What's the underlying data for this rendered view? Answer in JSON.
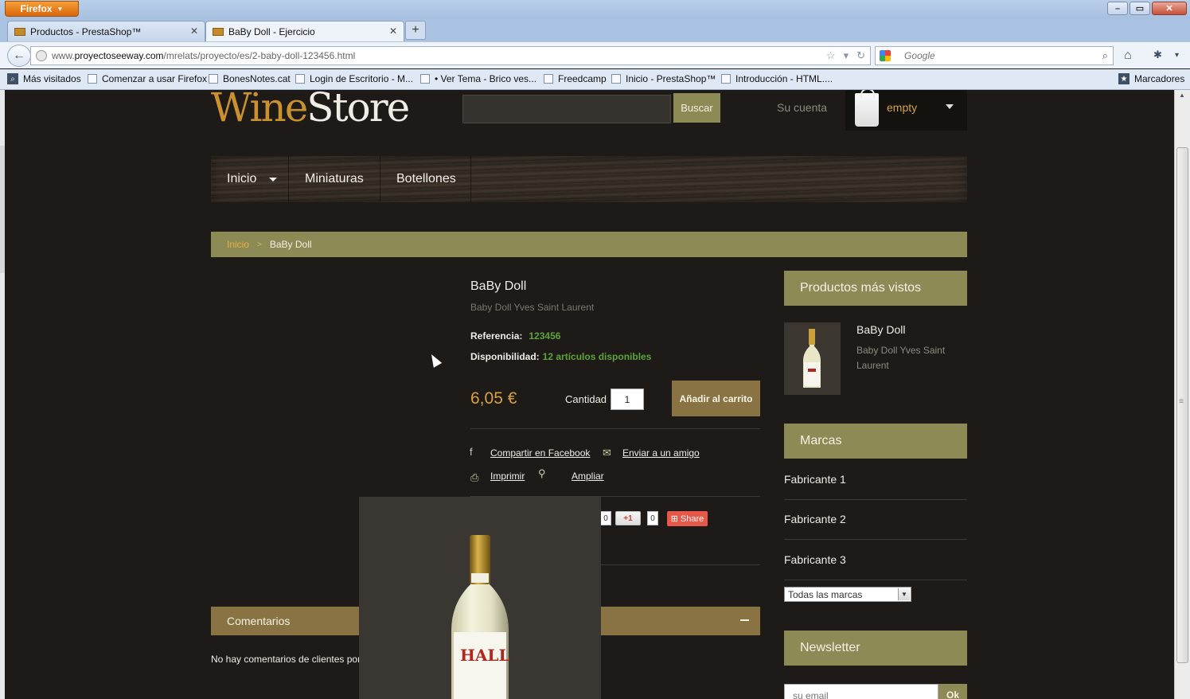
{
  "browser": {
    "app_button": "Firefox",
    "tabs": [
      {
        "title": "Productos - PrestaShop™",
        "active": false
      },
      {
        "title": "BaBy Doll - Ejercicio",
        "active": true
      }
    ],
    "url_prefix": "www.",
    "url_domain": "proyectoseeway.com",
    "url_path": "/mrelats/proyecto/es/2-baby-doll-123456.html",
    "search_placeholder": "Google",
    "bookmarks": [
      "Más visitados",
      "Comenzar a usar Firefox",
      "BonesNotes.cat",
      "Login de Escritorio - M...",
      "• Ver Tema - Brico ves...",
      "Freedcamp",
      "Inicio - PrestaShop™",
      "Introducción - HTML...."
    ],
    "bookmarks_menu": "Marcadores"
  },
  "header": {
    "logo_part1": "Wine",
    "logo_part2": "Store",
    "search_button": "Buscar",
    "account": "Su cuenta",
    "cart_status": "empty"
  },
  "menu": [
    "Inicio",
    "Miniaturas",
    "Botellones"
  ],
  "breadcrumb": {
    "home": "Inicio",
    "separator": ">",
    "current": "BaBy Doll"
  },
  "product": {
    "name": "BaBy Doll",
    "subtitle": "Baby Doll Yves Saint Laurent",
    "reference_label": "Referencia:",
    "reference_value": "123456",
    "availability_label": "Disponibilidad:",
    "availability_value": "12 artículos disponibles",
    "price": "6,05 €",
    "quantity_label": "Cantidad",
    "quantity_value": "1",
    "add_to_cart": "Añadir al carrito",
    "share_facebook": "Compartir en Facebook",
    "send_friend": "Enviar a un amigo",
    "print": "Imprimir",
    "enlarge": "Ampliar",
    "social": {
      "count_a": "0",
      "gplus": "+1",
      "count_b": "0",
      "share": "Share"
    },
    "bottle_label": "HALL"
  },
  "comments": {
    "title": "Comentarios",
    "empty_text": "No hay comentarios de clientes por ahora."
  },
  "sidebar": {
    "viewed_title": "Productos más vistos",
    "viewed_product_name": "BaBy Doll",
    "viewed_product_desc": "Baby Doll Yves Saint Laurent",
    "brands_title": "Marcas",
    "brands": [
      "Fabricante 1",
      "Fabricante 2",
      "Fabricante 3"
    ],
    "brands_select": "Todas las marcas",
    "newsletter_title": "Newsletter",
    "newsletter_placeholder": "su email",
    "newsletter_button": "Ok"
  },
  "colors": {
    "page_bg": "#1d1a17",
    "olive": "#8c8a55",
    "bronze": "#8a7343",
    "gold": "#d5a342",
    "green": "#5da33a"
  }
}
